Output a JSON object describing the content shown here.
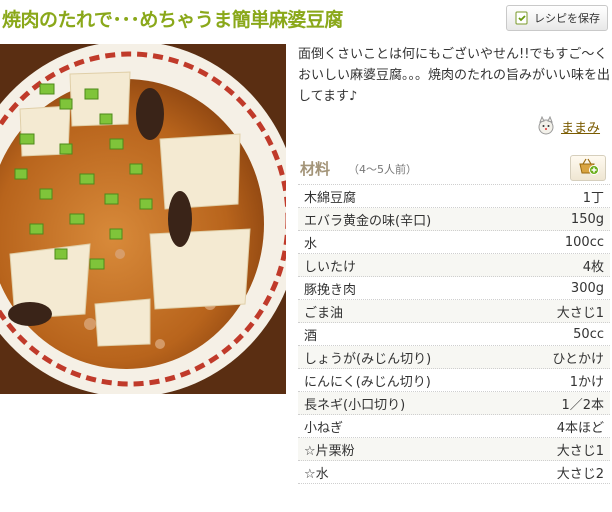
{
  "recipe": {
    "title": "焼肉のたれで･･･めちゃうま簡単麻婆豆腐",
    "description": "面倒くさいことは何にもございやせん!!でもすご～くおいしい麻婆豆腐。。。焼肉のたれの旨みがいい味を出してます♪"
  },
  "actions": {
    "save_label": "レシピを保存",
    "save_icon": "save-recipe-icon",
    "basket_icon": "basket-add-icon"
  },
  "author": {
    "name": "ままみ",
    "avatar_icon": "cat-avatar"
  },
  "ingredients": {
    "title": "材料",
    "servings": "（4～5人前）",
    "items": [
      {
        "name": "木綿豆腐",
        "amount": "1丁"
      },
      {
        "name": "エバラ黄金の味(辛口)",
        "amount": "150g"
      },
      {
        "name": "水",
        "amount": "100cc"
      },
      {
        "name": "しいたけ",
        "amount": "4枚"
      },
      {
        "name": "豚挽き肉",
        "amount": "300g"
      },
      {
        "name": "ごま油",
        "amount": "大さじ1"
      },
      {
        "name": "酒",
        "amount": "50cc"
      },
      {
        "name": "しょうが(みじん切り)",
        "amount": "ひとかけ"
      },
      {
        "name": "にんにく(みじん切り)",
        "amount": "1かけ"
      },
      {
        "name": "長ネギ(小口切り)",
        "amount": "1／2本"
      },
      {
        "name": "小ねぎ",
        "amount": "4本ほど"
      },
      {
        "name": "☆片栗粉",
        "amount": "大さじ1"
      },
      {
        "name": "☆水",
        "amount": "大さじ2"
      }
    ]
  },
  "colors": {
    "title": "#8aa81a",
    "ingredients_title": "#a39478",
    "author_link": "#7a5b00"
  }
}
